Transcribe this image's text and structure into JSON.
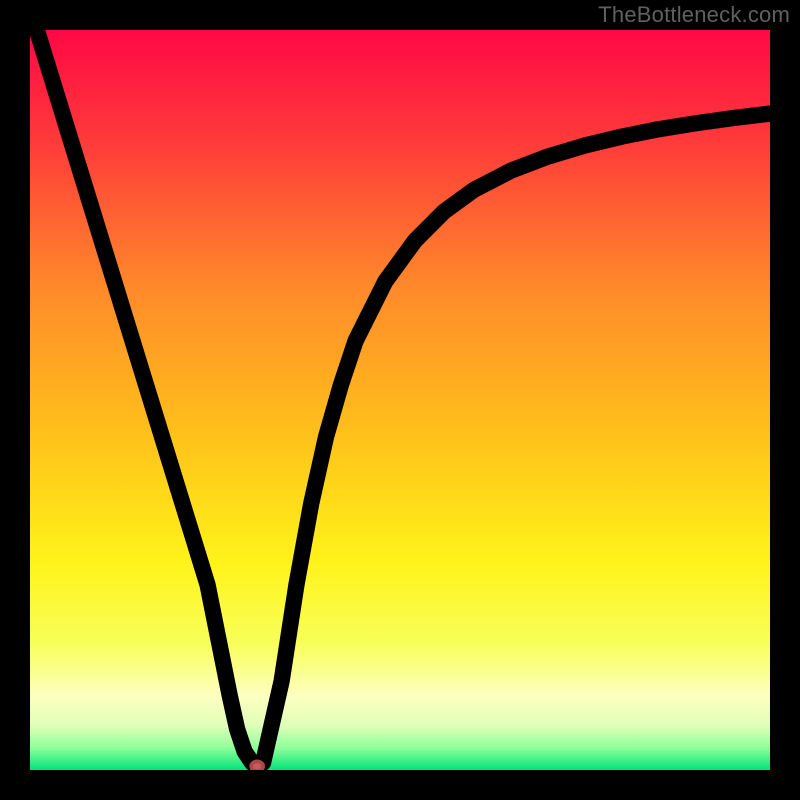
{
  "watermark": {
    "text": "TheBottleneck.com"
  },
  "chart_data": {
    "type": "line",
    "title": "",
    "xlabel": "",
    "ylabel": "",
    "xlim": [
      0,
      100
    ],
    "ylim": [
      0,
      100
    ],
    "grid": false,
    "legend": false,
    "background_gradient": {
      "stops": [
        {
          "pos": 0.0,
          "color": "#ff0844"
        },
        {
          "pos": 0.15,
          "color": "#ff3a3a"
        },
        {
          "pos": 0.35,
          "color": "#ff8a2a"
        },
        {
          "pos": 0.55,
          "color": "#ffc21a"
        },
        {
          "pos": 0.72,
          "color": "#fff31a"
        },
        {
          "pos": 0.83,
          "color": "#f8ff5a"
        },
        {
          "pos": 0.9,
          "color": "#fdffc0"
        },
        {
          "pos": 0.94,
          "color": "#dfffb8"
        },
        {
          "pos": 0.97,
          "color": "#8fff9a"
        },
        {
          "pos": 1.0,
          "color": "#00e47a"
        }
      ]
    },
    "series": [
      {
        "name": "bottleneck-curve",
        "x": [
          0,
          2,
          4,
          6,
          8,
          10,
          12,
          14,
          16,
          18,
          20,
          22,
          24,
          26,
          27,
          28,
          29,
          30,
          30.5,
          31,
          31.5,
          34,
          36,
          38,
          40,
          42,
          44,
          48,
          52,
          56,
          60,
          65,
          70,
          75,
          80,
          85,
          90,
          95,
          100
        ],
        "y": [
          103,
          96.5,
          90,
          83.5,
          77,
          70.5,
          64,
          57.5,
          51,
          44.5,
          38,
          31.5,
          25,
          15,
          10,
          5.5,
          2.5,
          1.0,
          0.6,
          0.6,
          1.0,
          12,
          25,
          36,
          45,
          52,
          58,
          66,
          71.5,
          75.5,
          78.4,
          81.0,
          82.9,
          84.4,
          85.6,
          86.6,
          87.4,
          88.1,
          88.7
        ]
      }
    ],
    "marker": {
      "x": 30.7,
      "y": 0.5,
      "color": "#c95a5a",
      "rx": 6,
      "ry": 5
    }
  }
}
